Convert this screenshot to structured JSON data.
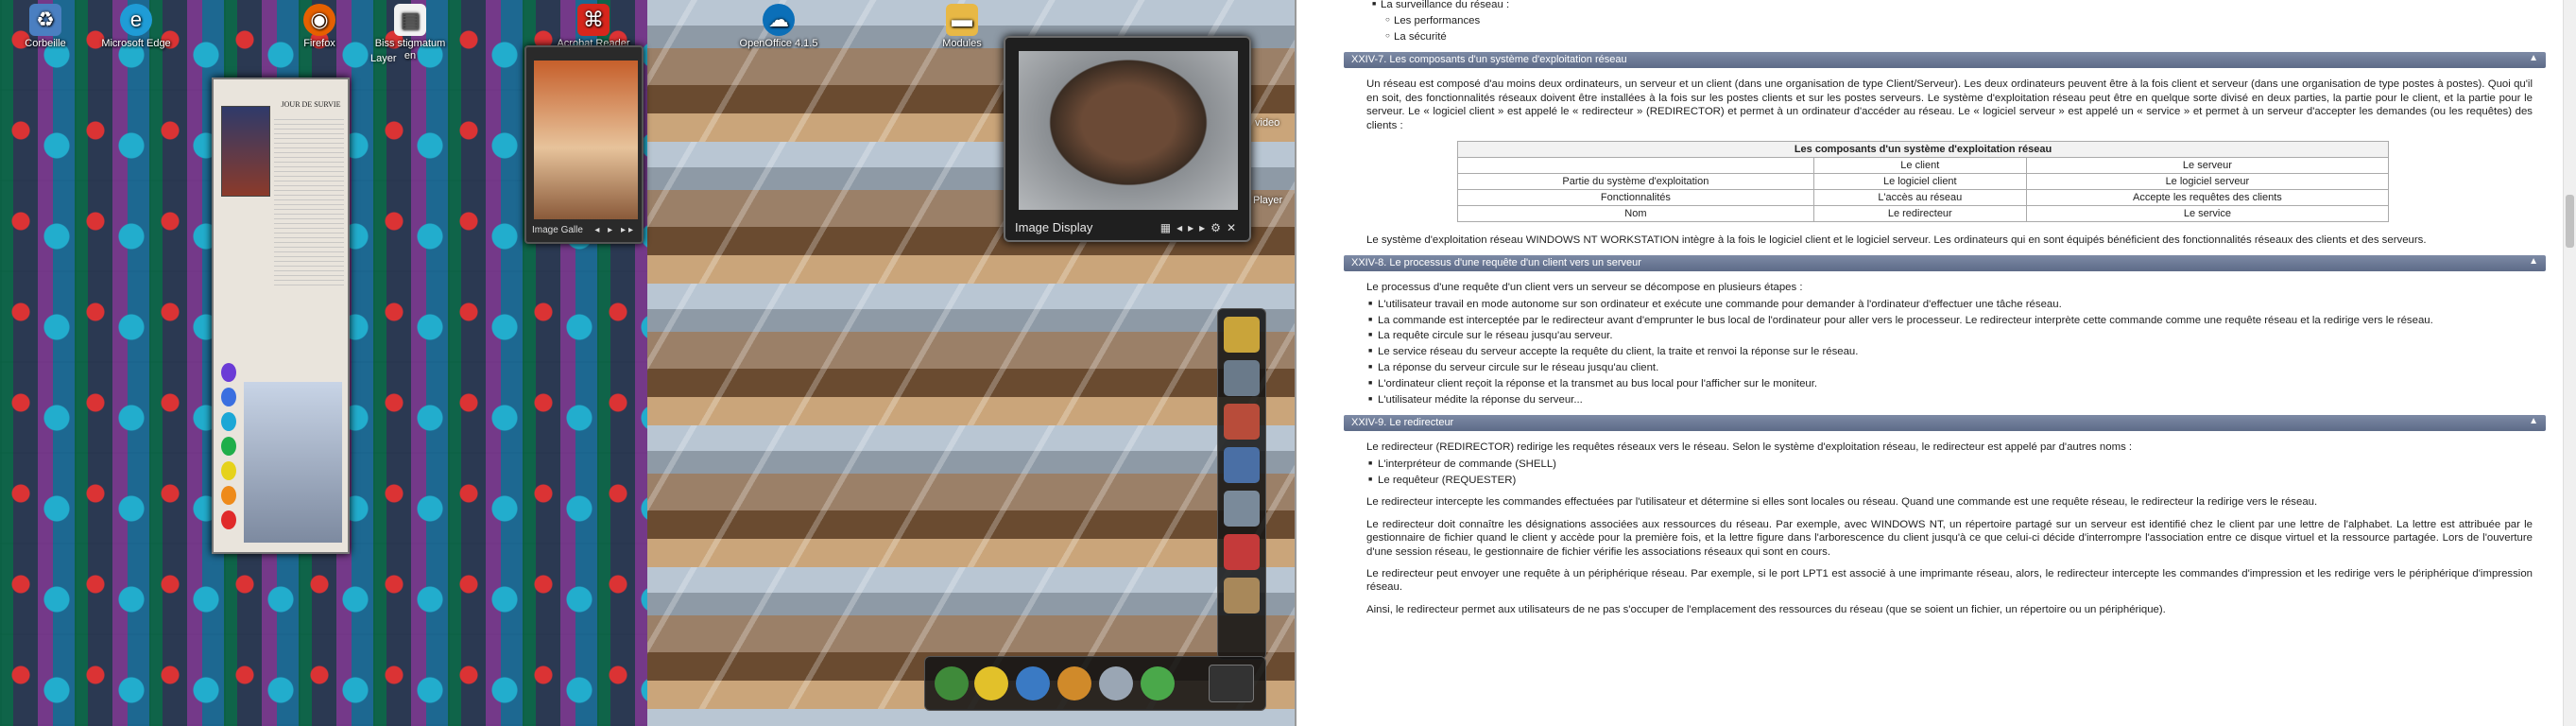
{
  "desktop": {
    "icons": [
      {
        "label": "Corbeille",
        "icon": "recycle-bin-icon",
        "color": "#4a7fc1"
      },
      {
        "label": "Microsoft Edge",
        "icon": "edge-icon",
        "color": "#1f9cd6"
      },
      {
        "label": "Firefox",
        "icon": "firefox-icon",
        "color": "#e66000"
      },
      {
        "label": "Biss stigmatum en",
        "icon": "document-icon",
        "color": "#f2f2f2"
      },
      {
        "label": "Acrobat Reader DC",
        "icon": "acrobat-icon",
        "color": "#d7261c"
      },
      {
        "label": "OpenOffice 4.1.5",
        "icon": "openoffice-icon",
        "color": "#0b6fb8"
      },
      {
        "label": "Modules",
        "icon": "folder-icon",
        "color": "#e8b845"
      }
    ],
    "ghost_labels": [
      "Layer",
      "video",
      "Player"
    ],
    "poster_title": "JOUR DE SURVIE",
    "photo_gadget_label": "Image Galle",
    "image_display": {
      "title": "Image Display"
    }
  },
  "doc": {
    "top_list": {
      "item": "La surveillance du réseau :",
      "sub": [
        "Les performances",
        "La sécurité"
      ]
    },
    "sections": [
      {
        "title": "XXIV-7. Les composants d'un système d'exploitation réseau",
        "paragraphs": [
          "Un réseau est composé d'au moins deux ordinateurs, un serveur et un client (dans une organisation de type Client/Serveur). Les deux ordinateurs peuvent être à la fois client et serveur (dans une organisation de type postes à postes). Quoi qu'il en soit, des fonctionnalités réseaux doivent être installées à la fois sur les postes clients et sur les postes serveurs. Le système d'exploitation réseau peut être en quelque sorte divisé en deux parties, la partie pour le client, et la partie pour le serveur. Le « logiciel client » est appelé le « redirecteur » (REDIRECTOR) et permet à un ordinateur d'accéder au réseau. Le « logiciel serveur » est appelé un « service » et permet à un serveur d'accepter les demandes (ou les requêtes) des clients :"
        ],
        "table": {
          "caption": "Les composants d'un système d'exploitation réseau",
          "header": [
            "",
            "Le client",
            "Le serveur"
          ],
          "rows": [
            [
              "Partie du système d'exploitation",
              "Le logiciel client",
              "Le logiciel serveur"
            ],
            [
              "Fonctionnalités",
              "L'accès au réseau",
              "Accepte les requêtes des clients"
            ],
            [
              "Nom",
              "Le redirecteur",
              "Le service"
            ]
          ]
        },
        "after": "Le système d'exploitation réseau WINDOWS NT WORKSTATION intègre à la fois le logiciel client et le logiciel serveur. Les ordinateurs qui en sont équipés bénéficient des fonctionnalités réseaux des clients et des serveurs."
      },
      {
        "title": "XXIV-8. Le processus d'une requête d'un client vers un serveur",
        "intro": "Le processus d'une requête d'un client vers un serveur se décompose en plusieurs étapes :",
        "list": [
          "L'utilisateur travail en mode autonome sur son ordinateur et exécute une commande pour demander à l'ordinateur d'effectuer une tâche réseau.",
          "La commande est interceptée par le redirecteur avant d'emprunter le bus local de l'ordinateur pour aller vers le processeur. Le redirecteur interprète cette commande comme une requête réseau et la redirige vers le réseau.",
          "La requête circule sur le réseau jusqu'au serveur.",
          "Le service réseau du serveur accepte la requête du client, la traite et renvoi la réponse sur le réseau.",
          "La réponse du serveur circule sur le réseau jusqu'au client.",
          "L'ordinateur client reçoit la réponse et la transmet au bus local pour l'afficher sur le moniteur.",
          "L'utilisateur médite la réponse du serveur..."
        ]
      },
      {
        "title": "XXIV-9. Le redirecteur",
        "intro": "Le redirecteur (REDIRECTOR) redirige les requêtes réseaux vers le réseau. Selon le système d'exploitation réseau, le redirecteur est appelé par d'autres noms :",
        "list": [
          "L'interpréteur de commande (SHELL)",
          "Le requêteur (REQUESTER)"
        ],
        "paragraphs": [
          "Le redirecteur intercepte les commandes effectuées par l'utilisateur et détermine si elles sont locales ou réseau. Quand une commande est une requête réseau, le redirecteur la redirige vers le réseau.",
          "Le redirecteur doit connaître les désignations associées aux ressources du réseau. Par exemple, avec WINDOWS NT, un répertoire partagé sur un serveur est identifié chez le client par une lettre de l'alphabet. La lettre est attribuée par le gestionnaire de fichier quand le client y accède pour la première fois, et la lettre figure dans l'arborescence du client jusqu'à ce que celui-ci décide d'interrompre l'association entre ce disque virtuel et la ressource partagée. Lors de l'ouverture d'une session réseau, le gestionnaire de fichier vérifie les associations réseaux qui sont en cours.",
          "Le redirecteur peut envoyer une requête à un périphérique réseau. Par exemple, si le port LPT1 est associé à une imprimante réseau, alors, le redirecteur intercepte les commandes d'impression et les redirige vers le périphérique d'impression réseau.",
          "Ainsi, le redirecteur permet aux utilisateurs de ne pas s'occuper de l'emplacement des ressources du réseau (que se soient un fichier, un répertoire ou un périphérique)."
        ]
      }
    ]
  }
}
